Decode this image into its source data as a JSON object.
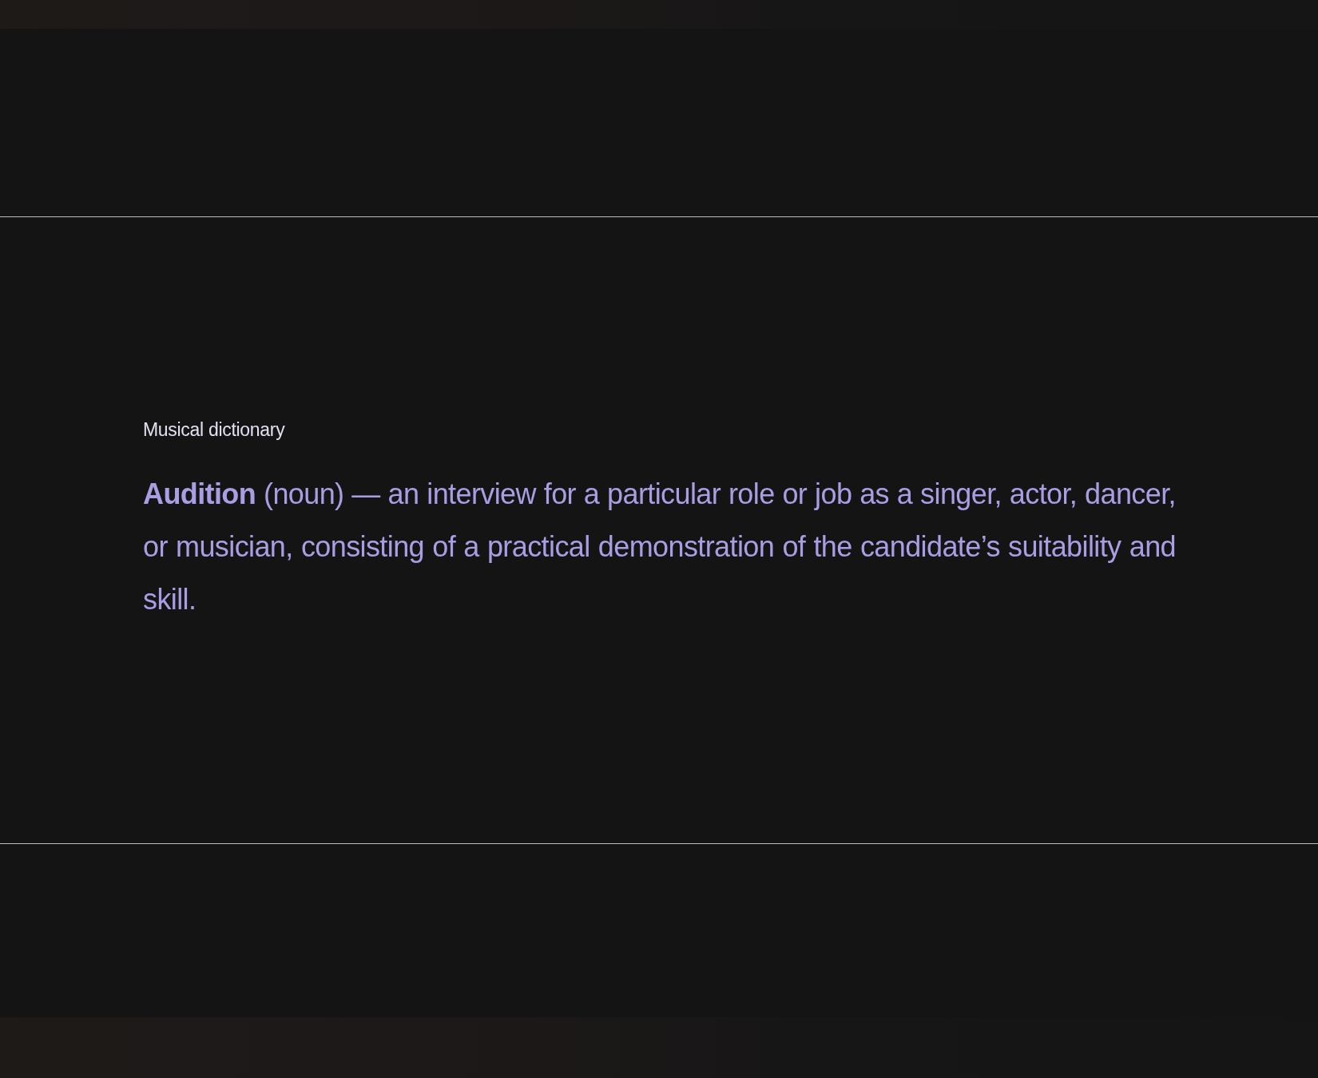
{
  "section": {
    "label": "Musical dictionary",
    "definition": "**Audition** (noun) — an interview for a particular role or job as a singer, actor, dancer, or musician, consisting of a practical demonstration of the candidate’s suitability and skill."
  }
}
